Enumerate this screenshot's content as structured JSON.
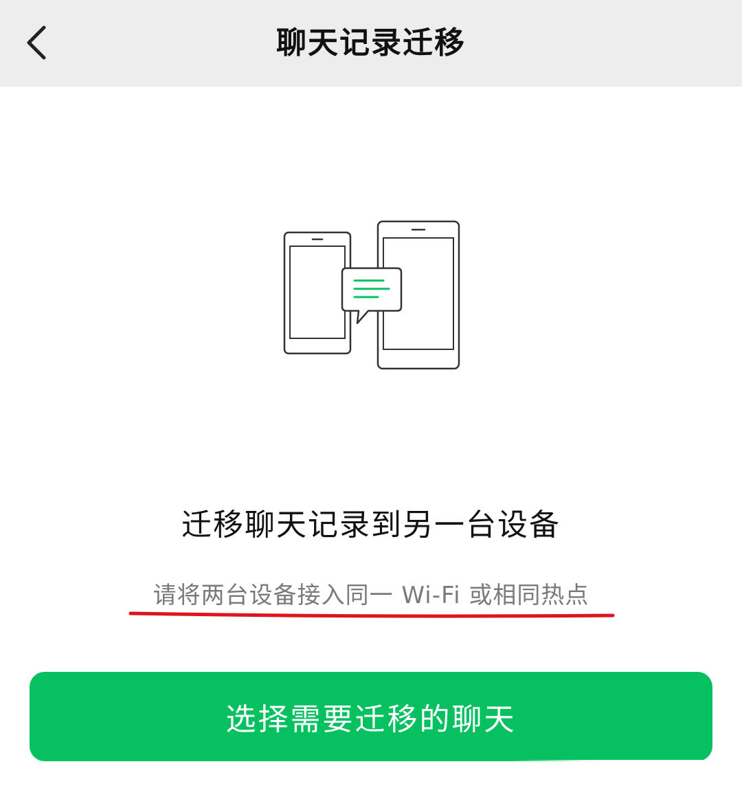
{
  "nav": {
    "title": "聊天记录迁移",
    "back_icon": "chevron-left-icon"
  },
  "illustration": {
    "icon": "phones-transfer-icon",
    "accent_color": "#07c160"
  },
  "content": {
    "heading": "迁移聊天记录到另一台设备",
    "hint": "请将两台设备接入同一 Wi-Fi 或相同热点"
  },
  "primary_button": {
    "label": "选择需要迁移的聊天",
    "color": "#07c160"
  },
  "annotation": {
    "underline_color": "#e0141e"
  }
}
